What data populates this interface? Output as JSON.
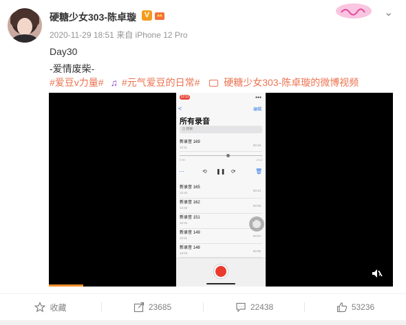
{
  "post": {
    "author": "硬糖少女303-陈卓璇",
    "verified_badge": "V",
    "meta": "2020-11-29 18:51 来自 iPhone 12 Pro",
    "text_line1": "Day30",
    "text_line2": "-爱情废柴-",
    "tags": {
      "tag1": "#爱豆v力量#",
      "tag2": "#元气爱豆的日常#",
      "video_source": "硬糖少女303-陈卓璇的微博视频"
    }
  },
  "video": {
    "progress": 0.1,
    "phone": {
      "status_time": "12:12",
      "back": "<",
      "edit": "编辑",
      "title": "所有录音",
      "search_placeholder": "Q 搜索",
      "now_playing": {
        "name": "新录音 169",
        "date": "12:11",
        "duration": "00:18"
      },
      "scrub_start": "0:00",
      "scrub_end": "-0:12",
      "recordings": [
        {
          "name": "新录音 165",
          "date": "12:42",
          "duration": "00:44"
        },
        {
          "name": "新录音 162",
          "date": "12:42",
          "duration": "00:05"
        },
        {
          "name": "新录音 151",
          "date": "12:31",
          "duration": "00:17"
        },
        {
          "name": "新录音 149",
          "date": "12:11",
          "duration": "00:07"
        },
        {
          "name": "新录音 148",
          "date": "12:03",
          "duration": "00:05"
        }
      ]
    }
  },
  "footer": {
    "favorite_label": "收藏",
    "repost_count": "23685",
    "comment_count": "22438",
    "like_count": "53236"
  },
  "colors": {
    "link": "#eb7350",
    "muted": "#808080",
    "video_progress": "#f08e2a"
  }
}
